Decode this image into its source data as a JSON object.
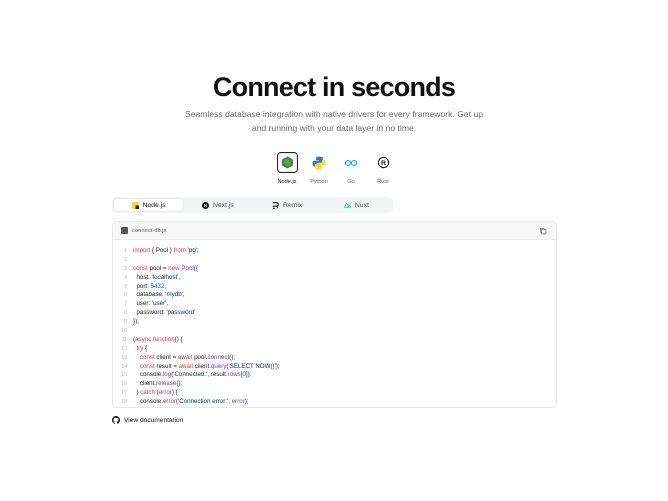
{
  "hero": {
    "title": "Connect in seconds",
    "subtitle": "Seamless database integration with native drivers for every framework. Get up and running with your data layer in no time."
  },
  "runtimes": [
    {
      "label": "Node.js",
      "icon": "nodejs-icon",
      "active": true
    },
    {
      "label": "Python",
      "icon": "python-icon",
      "active": false
    },
    {
      "label": "Go",
      "icon": "go-icon",
      "active": false
    },
    {
      "label": "Rust",
      "icon": "rust-icon",
      "active": false
    }
  ],
  "tabs": [
    {
      "label": "Node.js",
      "icon": "nodejs-icon",
      "active": true
    },
    {
      "label": "Next.js",
      "icon": "nextjs-icon",
      "active": false
    },
    {
      "label": "Remix",
      "icon": "remix-icon",
      "active": false
    },
    {
      "label": "Nuxt",
      "icon": "nuxt-icon",
      "active": false
    }
  ],
  "code": {
    "filename": "connect-db.js",
    "lines": [
      {
        "n": "1",
        "text": "import { Pool } from 'pg';"
      },
      {
        "n": "2",
        "text": ""
      },
      {
        "n": "3",
        "text": "const pool = new Pool({"
      },
      {
        "n": "4",
        "text": "  host: 'localhost',"
      },
      {
        "n": "5",
        "text": "  port: 5432,"
      },
      {
        "n": "6",
        "text": "  database: 'mydb',"
      },
      {
        "n": "7",
        "text": "  user: 'user',"
      },
      {
        "n": "8",
        "text": "  password: 'password'"
      },
      {
        "n": "9",
        "text": "});"
      },
      {
        "n": "10",
        "text": ""
      },
      {
        "n": "11",
        "text": "(async function() {"
      },
      {
        "n": "12",
        "text": "  try {"
      },
      {
        "n": "13",
        "text": "    const client = await pool.connect();"
      },
      {
        "n": "14",
        "text": "    const result = await client.query('SELECT NOW()');"
      },
      {
        "n": "15",
        "text": "    console.log('Connected:', result.rows[0]);"
      },
      {
        "n": "16",
        "text": "    client.release();"
      },
      {
        "n": "17",
        "text": "  } catch (error) {"
      },
      {
        "n": "18",
        "text": "    console.error('Connection error:', error);"
      }
    ]
  },
  "footer": {
    "doc_link": "View documentation"
  },
  "colors": {
    "node_green": "#3c873a",
    "python_blue": "#3776ab",
    "python_yellow": "#ffd43b",
    "go_cyan": "#00add8",
    "nuxt_green": "#00dc82"
  }
}
